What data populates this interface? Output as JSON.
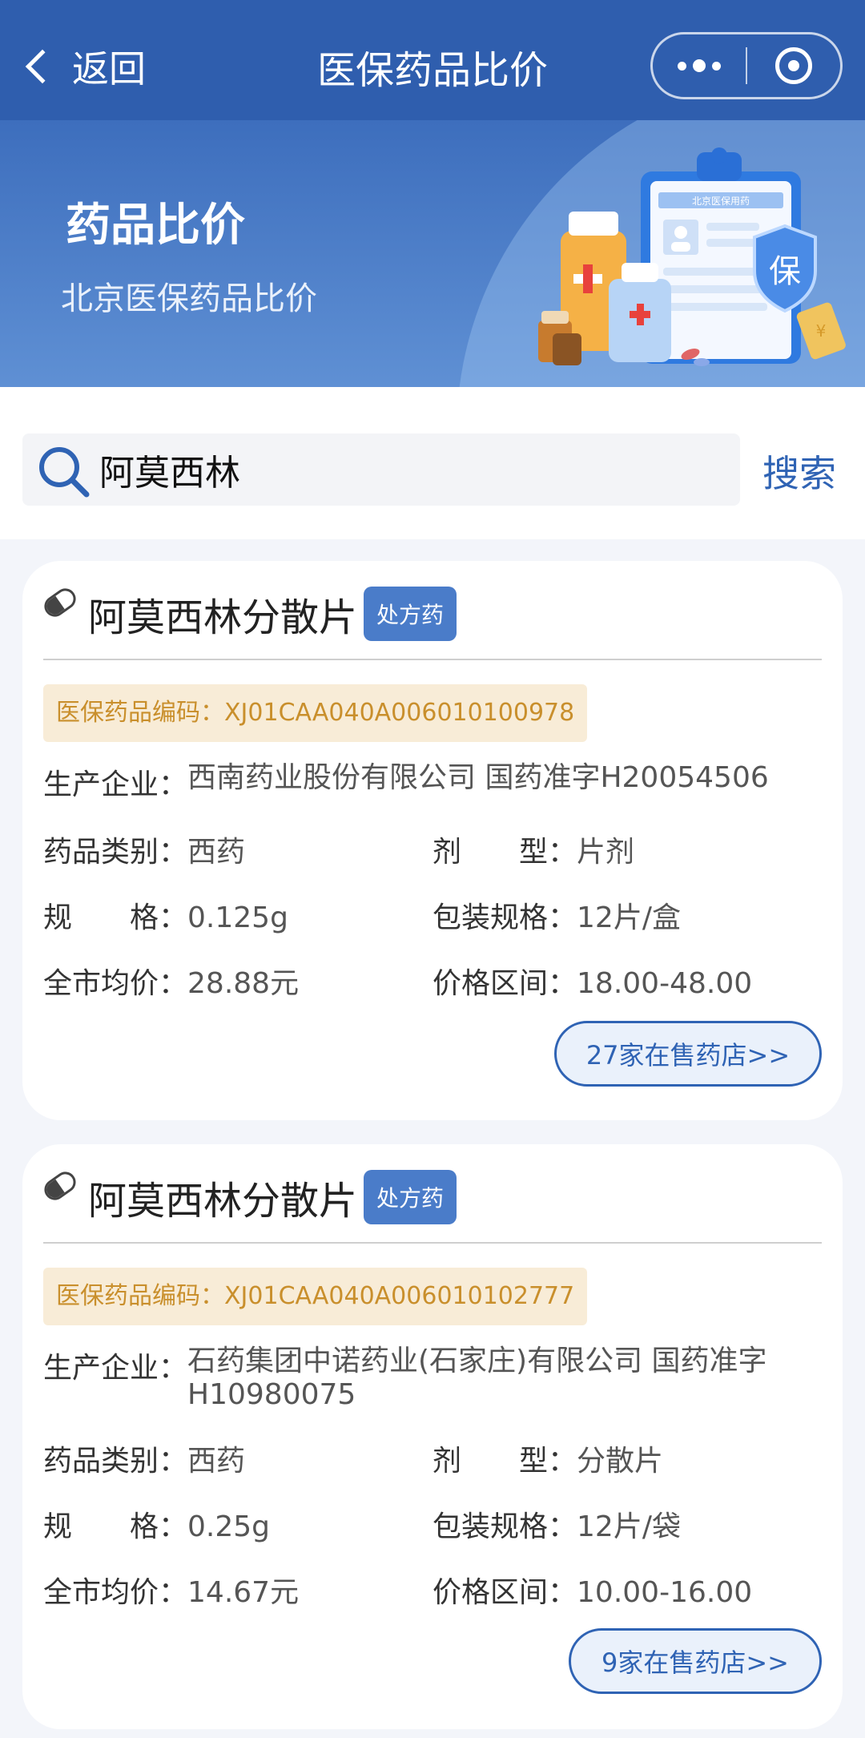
{
  "header": {
    "back_label": "返回",
    "title": "医保药品比价"
  },
  "banner": {
    "title": "药品比价",
    "subtitle": "北京医保药品比价",
    "clipboard_text": "北京医保用药",
    "shield_char": "保",
    "coin_char": "¥"
  },
  "search": {
    "value": "阿莫西林",
    "button_label": "搜索"
  },
  "labels": {
    "manufacturer": "生产企业：",
    "category": "药品类别：",
    "form": "剂　　型：",
    "spec": "规　　格：",
    "package": "包装规格：",
    "avg_price": "全市均价：",
    "price_range": "价格区间："
  },
  "drugs": [
    {
      "name": "阿莫西林分散片",
      "badge": "处方药",
      "code": "医保药品编码：XJ01CAA040A006010100978",
      "manufacturer": "西南药业股份有限公司   国药准字H20054506",
      "category": "西药",
      "form": "片剂",
      "spec": "0.125g",
      "package": "12片/盒",
      "avg_price": "28.88元",
      "price_range": "18.00-48.00",
      "stores": "27家在售药店>>"
    },
    {
      "name": "阿莫西林分散片",
      "badge": "处方药",
      "code": "医保药品编码：XJ01CAA040A006010102777",
      "manufacturer": "石药集团中诺药业(石家庄)有限公司   国药准字H10980075",
      "category": "西药",
      "form": "分散片",
      "spec": "0.25g",
      "package": "12片/袋",
      "avg_price": "14.67元",
      "price_range": "10.00-16.00",
      "stores": "9家在售药店>>"
    }
  ],
  "colors": {
    "header_bg": "#2f5eae",
    "accent": "#2f63b4",
    "badge_bg": "#4a7cc9",
    "code_bg": "#f8ecd7",
    "code_text": "#c98f2c"
  }
}
